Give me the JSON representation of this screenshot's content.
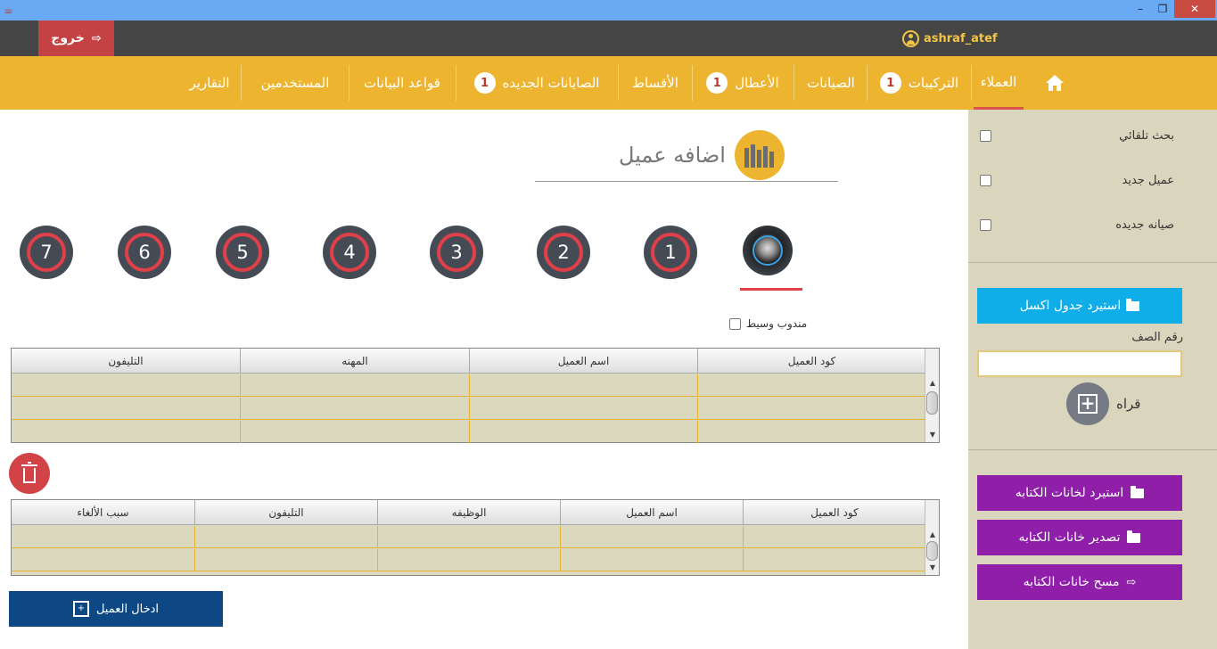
{
  "window": {
    "min": "–",
    "max": "❐",
    "close": "✕"
  },
  "userbar": {
    "logout_label": "خروج",
    "username": "ashraf_atef"
  },
  "nav": {
    "items": [
      {
        "label": "العملاء",
        "badge": ""
      },
      {
        "label": "التركيبات",
        "badge": "1"
      },
      {
        "label": "الصيانات",
        "badge": ""
      },
      {
        "label": "الأعطال",
        "badge": "1"
      },
      {
        "label": "الأقساط",
        "badge": ""
      },
      {
        "label": "الصايانات الجديده",
        "badge": "1"
      },
      {
        "label": "قواعد البيانات",
        "badge": ""
      },
      {
        "label": "المستخدمين",
        "badge": ""
      },
      {
        "label": "التقارير",
        "badge": ""
      }
    ]
  },
  "sidebar": {
    "checks": [
      "بحث تلقائي",
      "عميل جديد",
      "صيانه جديده"
    ],
    "import_excel": "استيرد جدول اكسل",
    "row_label": "رقم الصف",
    "row_value": "",
    "read_label": "قراه",
    "import_fields": "استيرد لخانات الكتابه",
    "export_fields": "تصدير خانات الكتابه",
    "clear_fields": "مسح خانات الكتابه"
  },
  "main": {
    "title": "اضافه عميل",
    "steps": [
      "1",
      "2",
      "3",
      "4",
      "5",
      "6",
      "7"
    ],
    "mandoub_label": "مندوب وسيط",
    "table1": {
      "headers": [
        "كود العميل",
        "اسم العميل",
        "المهنه",
        "التليفون"
      ]
    },
    "table2": {
      "headers": [
        "كود العميل",
        "اسم العميل",
        "الوظيفه",
        "التليفون",
        "سبب الألغاء"
      ]
    },
    "enter_button": "ادخال العميل"
  }
}
